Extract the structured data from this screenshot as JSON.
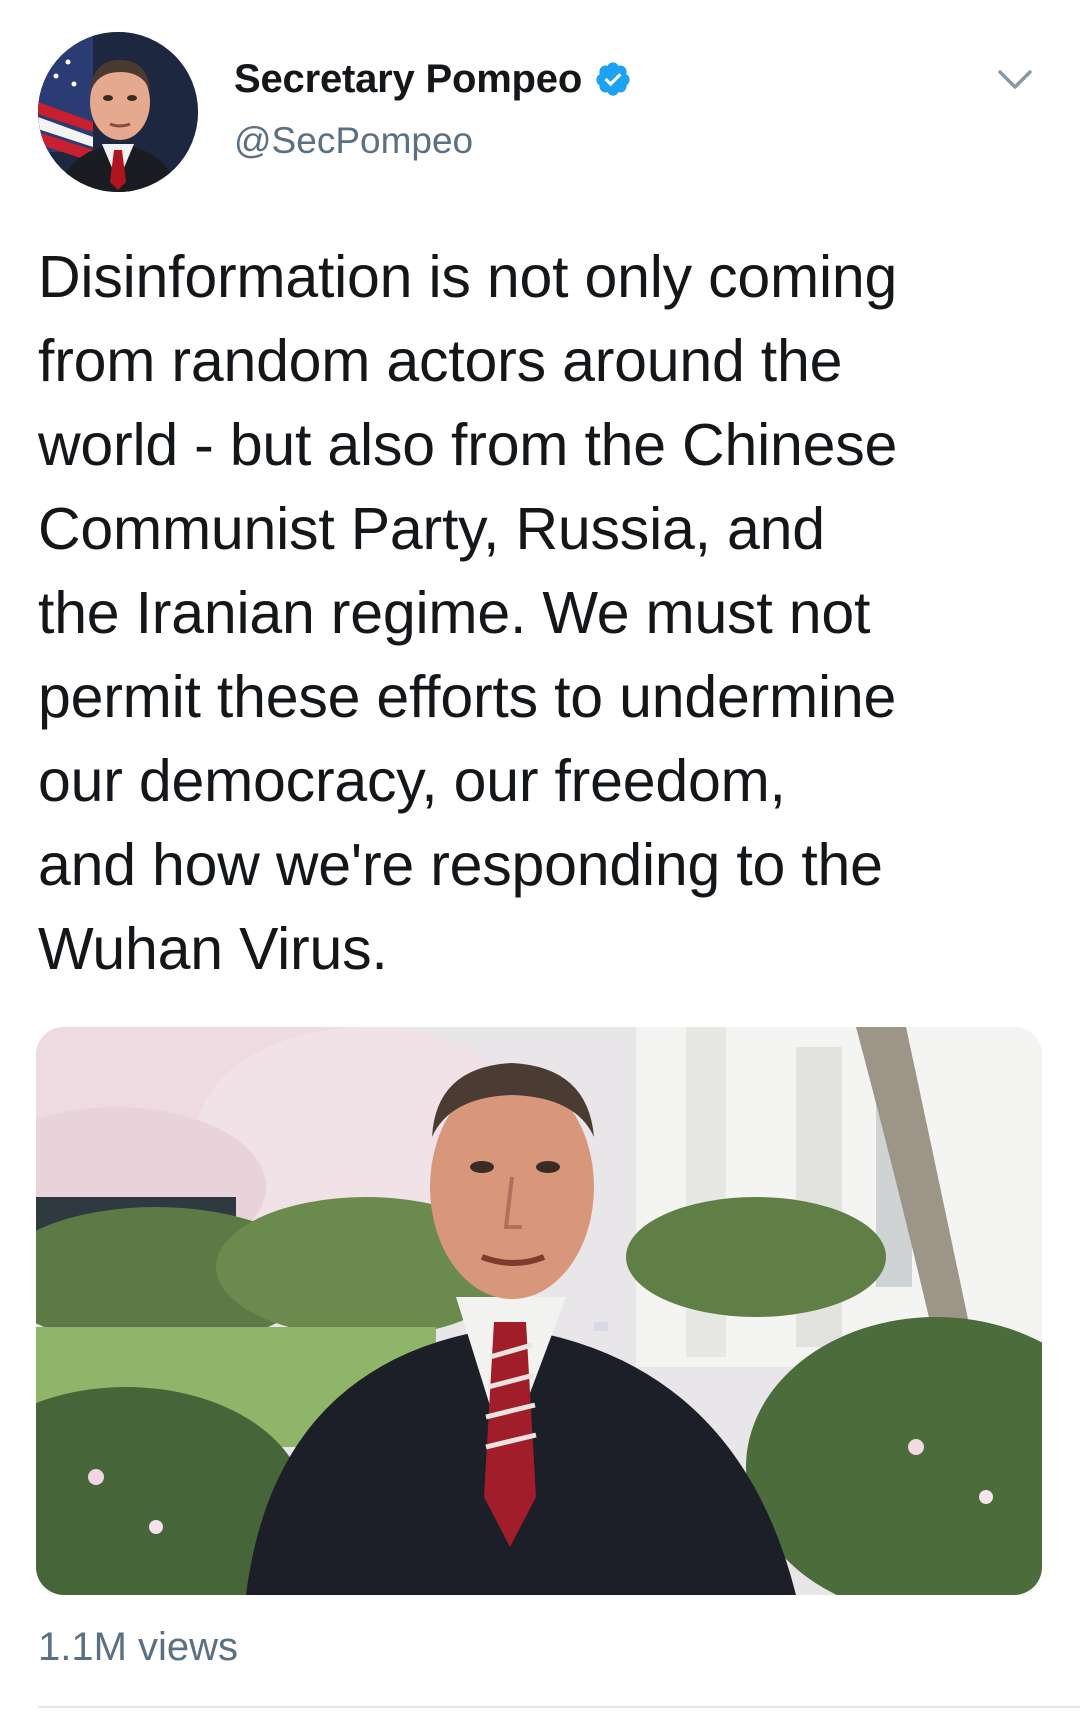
{
  "tweet": {
    "display_name": "Secretary Pompeo",
    "handle": "@SecPompeo",
    "text_lines": [
      "Disinformation is not only coming",
      "from random actors around the",
      "world - but also from the Chinese",
      "Communist Party, Russia, and",
      "the Iranian regime. We must not",
      "permit these efforts to undermine",
      "our democracy, our freedom,",
      "and how we're responding to the",
      "Wuhan Virus."
    ],
    "views": "1.1M views"
  },
  "icons": {
    "verified": "verified-badge-icon",
    "menu": "chevron-down-icon"
  },
  "colors": {
    "verified_blue": "#1da1f2",
    "secondary_text": "#5b7083",
    "primary_text": "#14171a"
  }
}
